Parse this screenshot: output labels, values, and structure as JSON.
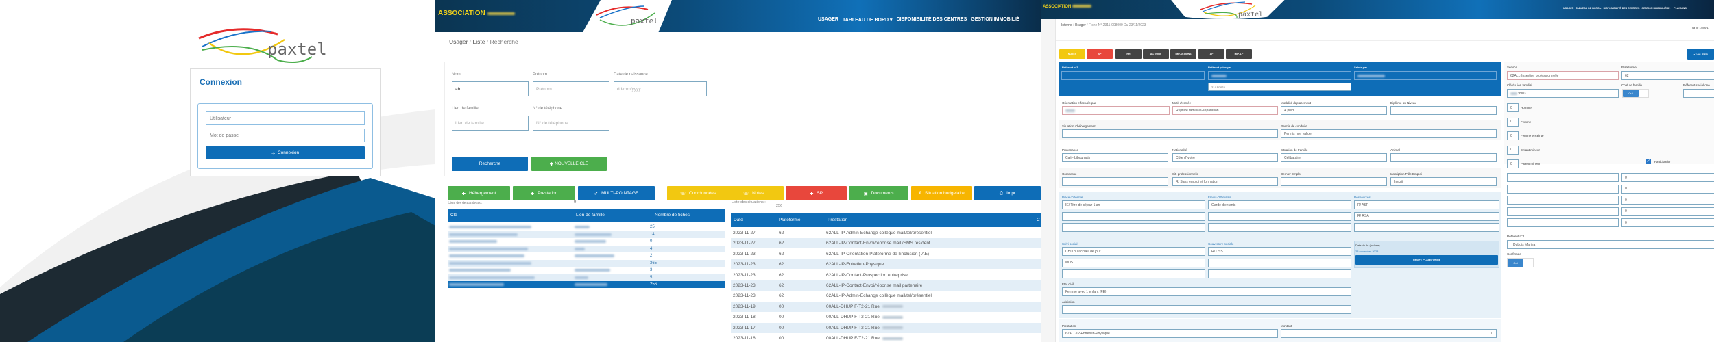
{
  "login": {
    "brand": "paxtel",
    "title": "Connexion",
    "user_placeholder": "Utilisateur",
    "password_placeholder": "Mot de passe",
    "submit_label": "Connexion"
  },
  "liste": {
    "association": "ASSOCIATION",
    "brand": "paxtel",
    "nav": [
      "USAGER",
      "TABLEAU DE BORD ▾",
      "DISPONIBILITÉ DES CENTRES",
      "GESTION IMMOBILIÈ"
    ],
    "breadcrumb": [
      "Usager",
      "Liste",
      "Recherche"
    ],
    "search": {
      "nom_label": "Nom",
      "nom_value": "ab",
      "prenom_label": "Prénom",
      "prenom_placeholder": "Prénom",
      "date_label": "Date de naissance",
      "date_placeholder": "dd/mm/yyyy",
      "lien_label": "Lien de famille",
      "lien_placeholder": "Lien de famille",
      "tel_label": "N° de téléphone",
      "tel_placeholder": "N° de téléphone",
      "search_button": "Recherche",
      "new_button": "NOUVELLE CLÉ"
    },
    "actions": [
      {
        "label": "Hébergement",
        "icon": "✚",
        "color": "#4cae4c"
      },
      {
        "label": "Prestation",
        "icon": "✚",
        "color": "#4cae4c"
      },
      {
        "label": "MULTI-POINTAGE",
        "icon": "✔",
        "color": "#0e6db7"
      },
      {
        "label": "Coordonnées",
        "icon": "☏",
        "color": "#f2c811"
      },
      {
        "label": "Notes",
        "icon": "☏",
        "color": "#f2c811"
      },
      {
        "label": "SP",
        "icon": "✚",
        "color": "#e8473c"
      },
      {
        "label": "Documents",
        "icon": "▣",
        "color": "#4cae4c"
      },
      {
        "label": "Situation budgetaire",
        "icon": "€",
        "color": "#f7b500"
      },
      {
        "label": "Impr",
        "icon": "⎙",
        "color": "#0e6db7"
      }
    ],
    "demandeurs": {
      "title": "Liste des demandeurs :",
      "count": "9",
      "headers": [
        "Clé",
        "Lien de famille",
        "Nombre de fiches"
      ],
      "counts": [
        "25",
        "14",
        "0",
        "4",
        "2",
        "365",
        "3",
        "5",
        "256"
      ]
    },
    "situations": {
      "title": "Liste des situations :",
      "count": "256",
      "headers": [
        "Date",
        "Plateforme",
        "Prestation",
        "C"
      ],
      "rows": [
        [
          "2023-11-27",
          "62",
          "62ALL-IP-Admin-Echange collègue mail/tel/présentiel"
        ],
        [
          "2023-11-27",
          "62",
          "62ALL-IP-Contact-Envoi/réponse mail /SMS résident"
        ],
        [
          "2023-11-23",
          "62",
          "62ALL-IP-Orientation-Plateforme de l'inclusion (IAE)"
        ],
        [
          "2023-11-23",
          "62",
          "62ALL-IP-Entretien-Physique"
        ],
        [
          "2023-11-23",
          "62",
          "62ALL-IP-Contact-Prospection entreprise"
        ],
        [
          "2023-11-23",
          "62",
          "62ALL-IP-Contact-Envoi/réponse mail partenaire"
        ],
        [
          "2023-11-23",
          "62",
          "62ALL-IP-Admin-Echange collègue mail/tel/présentiel"
        ],
        [
          "2023-11-19",
          "00",
          "00ALL-DHUP F-T2-21 Rue"
        ],
        [
          "2023-11-18",
          "00",
          "00ALL-DHUP F-T2-21 Rue"
        ],
        [
          "2023-11-17",
          "00",
          "00ALL-DHUP F-T2-21 Rue"
        ],
        [
          "2023-11-16",
          "00",
          "00ALL-DHUP F-T2-21 Rue"
        ]
      ]
    }
  },
  "fiche": {
    "association": "ASSOCIATION",
    "brand": "paxtel",
    "nav": "USAGER   TABLEAU DE BORD ▾   DISPONIBILITÉ DES CENTRES   GESTION IMMOBILIÈRE ▾   PLANNING",
    "breadcrumb": [
      "Interne",
      "Usager",
      "Fiche N° 2311-008009 Du 23/11/2023"
    ],
    "birth": "Né le 14/06/1",
    "tabs": [
      {
        "label": "NOTES",
        "color": "#f2c811"
      },
      {
        "label": "SP",
        "color": "#e8473c"
      },
      {
        "label": "NR",
        "color": "#444"
      },
      {
        "label": "ACTIONS",
        "color": "#444"
      },
      {
        "label": "IMP.ACTIONS",
        "color": "#444"
      },
      {
        "label": "AF",
        "color": "#444"
      },
      {
        "label": "IMP.A.F",
        "color": "#444"
      }
    ],
    "validate": "✔ VALIDER",
    "ref3_label": "Référent n°3",
    "refp_label": "Référent principal",
    "refp_date": "21/11/2023",
    "saisie_label": "Saisie par",
    "fields": {
      "orient": {
        "label": "Orientation effectuée par",
        "value": ""
      },
      "motif": {
        "label": "Motif d'entrée",
        "value": "Rupture familiale-séparation"
      },
      "modal": {
        "label": "Modalité déplacement",
        "value": "A pied"
      },
      "diplome": {
        "label": "Diplôme ou Niveau",
        "value": ""
      },
      "heberg": {
        "label": "Situation d'hébergement",
        "value": ""
      },
      "permis": {
        "label": "Permis de conduire",
        "value": "Permis non valide"
      },
      "prov": {
        "label": "Provenance",
        "value": "Cali - Libournais"
      },
      "nat": {
        "label": "Nationalité",
        "value": "Côte d'Ivoire"
      },
      "sitfam": {
        "label": "Situation de Famille",
        "value": "Célibataire"
      },
      "animal": {
        "label": "Animal",
        "value": ""
      },
      "gross": {
        "label": "Grossesse",
        "value": ""
      },
      "sitpro": {
        "label": "Sit. professionnelle",
        "value": "R/ Sans emploi et formation"
      },
      "dernier": {
        "label": "Dernier Emploi",
        "value": ""
      },
      "pole": {
        "label": "Inscription Pôle Emploi",
        "value": "Inscrit"
      },
      "etat": {
        "label": "Etat civil",
        "value": "Femme avec 1 enfant (FE)"
      },
      "addiction": {
        "label": "Addiction",
        "value": ""
      },
      "prestation": {
        "label": "Prestation",
        "value": "62ALL-IP-Entretien-Physique"
      },
      "montant": {
        "label": "Montant",
        "value": "0"
      }
    },
    "groups": {
      "piece": {
        "label": "Pièce d'identité",
        "values": [
          "IE/ Titre de séjour 1 an",
          "",
          ""
        ]
      },
      "freins": {
        "label": "Freins-Difficultés",
        "values": [
          "Garde d'enfants",
          "",
          ""
        ]
      },
      "ressources": {
        "label": "Ressources",
        "values": [
          "R/ ASF",
          "R/ RSA",
          ""
        ]
      },
      "suivi": {
        "label": "Suivi social",
        "values": [
          "CHU ou accueil de jour",
          "MDS",
          ""
        ]
      },
      "couverture": {
        "label": "Couverture sociale",
        "values": [
          "R/ CSS",
          "",
          ""
        ]
      }
    },
    "date_fin_label": "Date de fin (incluse)",
    "date_fin_value": "23 novembre 2023",
    "ghgft_button": "GHGFT PLATEFORME",
    "service_label": "Service",
    "service_value": "62ALL-Insertion professionnelle",
    "plateforme_label": "Plateforme",
    "plateforme_value": "62",
    "cle_label": "Clé du lien familial",
    "cle_value": "9903",
    "chef_label": "Chef de famille",
    "chef_value": "Oui",
    "refsoc_label": "Référent social one",
    "counts": [
      {
        "label": "Homme",
        "value": "0"
      },
      {
        "label": "Femme",
        "value": "0"
      },
      {
        "label": "Femme enceinte",
        "value": "0"
      },
      {
        "label": "Enfant mineur",
        "value": "0"
      },
      {
        "label": "Parent mineur",
        "value": "0"
      }
    ],
    "participation": "Participation",
    "amounts": [
      "0",
      "0",
      "0",
      "0",
      "0"
    ],
    "ref2_label": "Référent n°2",
    "ref2_value": "Dubois Marina",
    "confirmee_label": "Confirmée",
    "confirmee_value": "Oui"
  },
  "colors": {
    "primary": "#0e6db7",
    "header": "#0b3d6b",
    "yellow": "#f2c811",
    "green": "#4cae4c",
    "red": "#e8473c"
  }
}
